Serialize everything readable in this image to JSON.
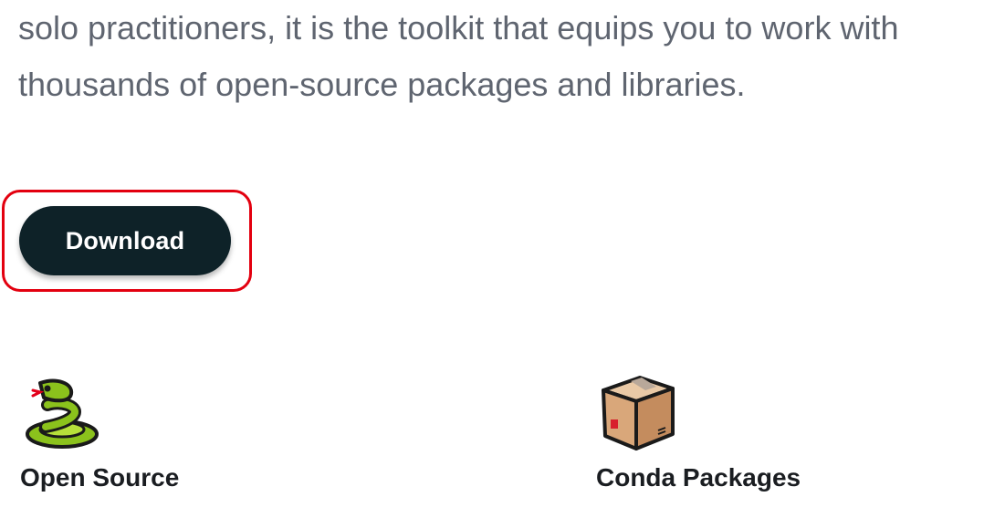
{
  "intro": {
    "line1": "solo practitioners, it is the toolkit that equips you to work with",
    "line2": "thousands of open-source packages and libraries."
  },
  "cta": {
    "download_label": "Download",
    "button_color": "#0e2228",
    "highlight_color": "#e3000f"
  },
  "features": [
    {
      "icon": "snake-icon",
      "label": "Open Source"
    },
    {
      "icon": "package-box-icon",
      "label": "Conda Packages"
    }
  ]
}
